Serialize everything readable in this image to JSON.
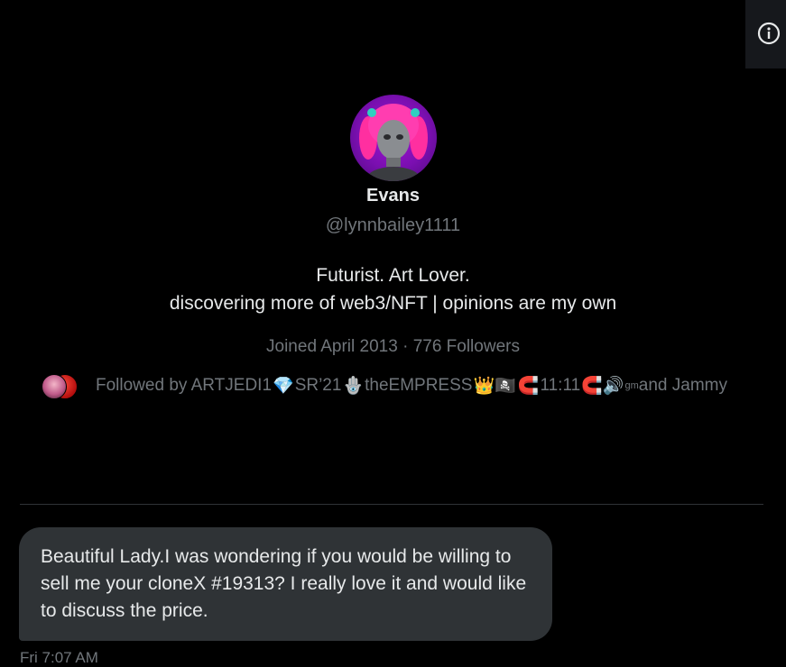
{
  "profile": {
    "display_name": "Evans",
    "handle": "@lynnbailey1111",
    "bio_line1": "Futurist. Art Lover.",
    "bio_line2": "discovering more of web3/NFT | opinions are my own",
    "joined": "Joined April 2013",
    "separator": "·",
    "followers": "776 Followers"
  },
  "followed_by": {
    "prefix": "Followed by ARTJEDI1",
    "emoji1": "💎",
    "name2": "SR’21",
    "emoji2": "🪬",
    "name3": " theEMPRESS",
    "emoji3": "👑🏴‍☠️",
    "emoji4": "🧲",
    "name4": "11:11",
    "emoji5": "🧲🔊",
    "sup": "gm",
    "suffix": " and Jammy"
  },
  "message": {
    "text": "Beautiful Lady.I was wondering if you would be willing to sell me your cloneX #19313? I really love it and would like to discuss the price.",
    "time": "Fri 7:07 AM"
  },
  "icons": {
    "info": "info-icon",
    "avatar": "profile-avatar"
  },
  "colors": {
    "background": "#000000",
    "text": "#e7e9ea",
    "secondary_text": "#71767b",
    "bubble": "#2f3336",
    "divider": "#2f3336",
    "avatar_bg": "#a313d6"
  }
}
